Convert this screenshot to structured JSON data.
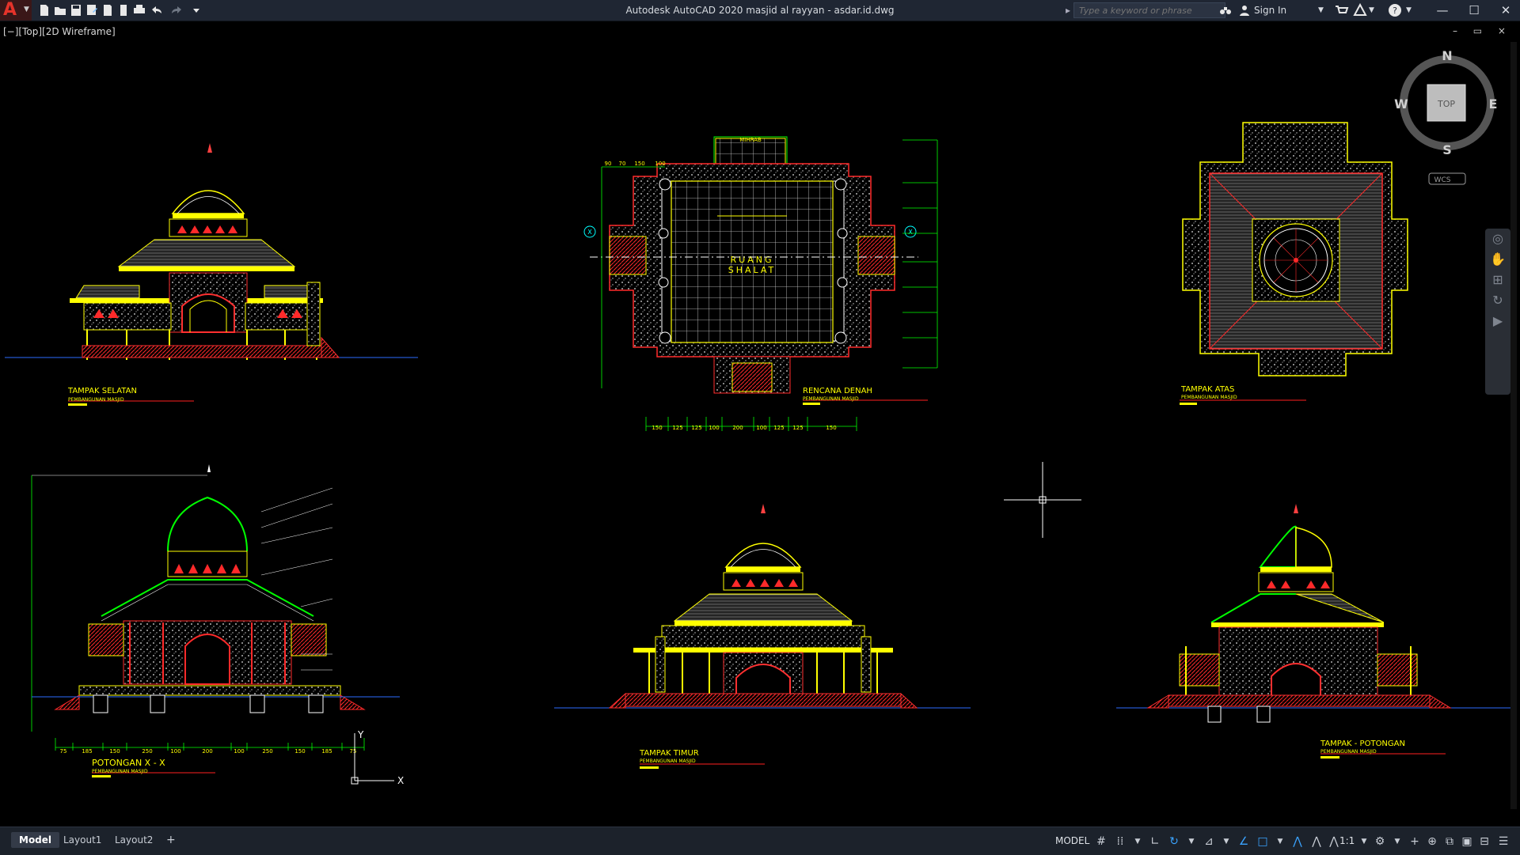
{
  "window": {
    "title": "Autodesk AutoCAD 2020    masjid al rayyan - asdar.id.dwg",
    "search_placeholder": "Type a keyword or phrase",
    "sign_in": "Sign In",
    "minimize": "—",
    "maximize": "☐",
    "close": "✕"
  },
  "viewport": {
    "label": "[−][Top][2D Wireframe]",
    "controls": "–  ▭  ×"
  },
  "viewcube": {
    "face": "TOP",
    "north": "N",
    "south": "S",
    "east": "E",
    "west": "W",
    "ucs": "WCS"
  },
  "drawings": {
    "tampak_selatan": {
      "title": "TAMPAK SELATAN",
      "subtitle": "PEMBANGUNAN MASJID"
    },
    "rencana_denah": {
      "title": "RENCANA DENAH",
      "subtitle": "PEMBANGUNAN MASJID",
      "room1": "RUANG",
      "room2": "SHALAT",
      "mihrab": "MIHRAB",
      "axis": "X"
    },
    "tampak_atas": {
      "title": "TAMPAK ATAS",
      "subtitle": "PEMBANGUNAN MASJID"
    },
    "potongan_xx": {
      "title": "POTONGAN  X - X",
      "subtitle": "PEMBANGUNAN MASJID"
    },
    "tampak_timur": {
      "title": "TAMPAK TIMUR",
      "subtitle": "PEMBANGUNAN MASJID"
    },
    "tampak_potongan": {
      "title": "TAMPAK - POTONGAN",
      "subtitle": "PEMBANGUNAN MASJID"
    },
    "plan_bottom_dims": [
      "150",
      "125",
      "125",
      "100",
      "200",
      "100",
      "125",
      "125",
      "150"
    ],
    "plan_top_dims": [
      "90",
      "70",
      "150",
      "100"
    ],
    "section_bottom_dims": [
      "75",
      "185",
      "150",
      "250",
      "100",
      "200",
      "100",
      "250",
      "150",
      "185",
      "75"
    ]
  },
  "ucs_icon": {
    "x": "X",
    "y": "Y"
  },
  "status": {
    "tabs": [
      "Model",
      "Layout1",
      "Layout2"
    ],
    "add_tab": "+",
    "model": "MODEL",
    "scale": "1:1"
  },
  "colors": {
    "title_bg": "#1f2633",
    "status_bg": "#1c222b",
    "canvas": "#000000",
    "accent": "#3aa3ff",
    "yellow": "#ffff00",
    "red": "#ff0000",
    "white": "#ffffff",
    "green": "#00ff00",
    "blue": "#2d6bff"
  }
}
